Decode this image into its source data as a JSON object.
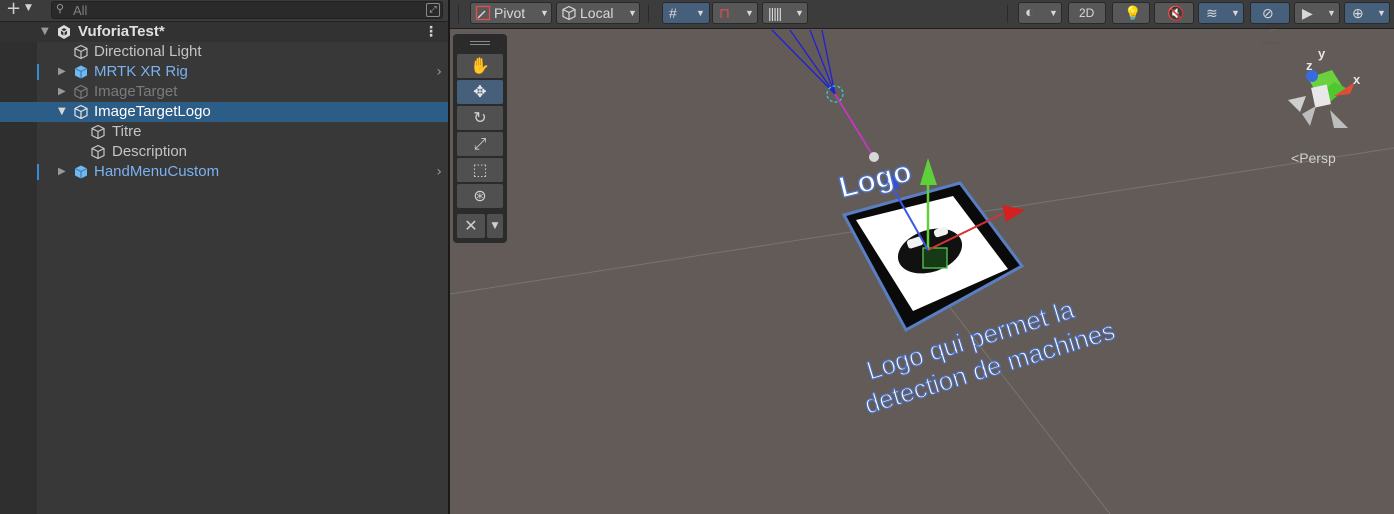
{
  "hierarchy": {
    "search_placeholder": "All",
    "scene_name": "VuforiaTest*",
    "items": [
      {
        "label": "Directional Light"
      },
      {
        "label": "MRTK XR Rig"
      },
      {
        "label": "ImageTarget"
      },
      {
        "label": "ImageTargetLogo"
      },
      {
        "label": "Titre"
      },
      {
        "label": "Description"
      },
      {
        "label": "HandMenuCustom"
      }
    ]
  },
  "scene_toolbar": {
    "pivot_label": "Pivot",
    "local_label": "Local",
    "mode_2d_label": "2D"
  },
  "scene_view": {
    "persp_label": "Persp",
    "gizmo_axes": {
      "x": "x",
      "y": "y",
      "z": "z"
    },
    "logo_text": "Logo",
    "description_line1": "Logo qui permet la",
    "description_line2": "detection de machines"
  },
  "colors": {
    "selection": "#2c5d87",
    "prefab_text": "#7bb1ef",
    "scene_bg": "#625b57",
    "toggle_on": "#46607c"
  }
}
